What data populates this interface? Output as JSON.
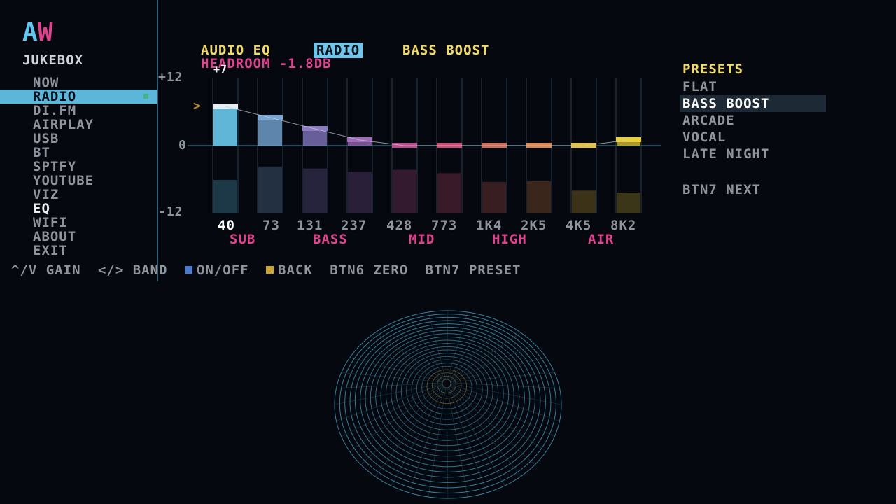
{
  "brand": {
    "logo_a": "A",
    "logo_w": "W",
    "title": "JUKEBOX"
  },
  "menu": {
    "items": [
      {
        "label": "NOW"
      },
      {
        "label": "RADIO",
        "selected": true
      },
      {
        "label": "DI.FM"
      },
      {
        "label": "AIRPLAY"
      },
      {
        "label": "USB"
      },
      {
        "label": "BT"
      },
      {
        "label": "SPTFY"
      },
      {
        "label": "YOUTUBE"
      },
      {
        "label": "VIZ"
      },
      {
        "label": "EQ",
        "current": true
      },
      {
        "label": "WIFI"
      },
      {
        "label": "ABOUT"
      },
      {
        "label": "EXIT"
      }
    ]
  },
  "eq": {
    "title": "AUDIO EQ",
    "source": "RADIO",
    "preset": "BASS BOOST",
    "headroom": "HEADROOM -1.8DB",
    "gain_popup": "+7",
    "y_max_label": "+12",
    "y_zero_label": "0",
    "y_min_label": "-12",
    "ylim": [
      -12,
      12
    ],
    "selected_band": 0,
    "bands": [
      {
        "freq": "40",
        "gain": 7,
        "color": "#5fb6d6",
        "cap": "#e8ecf0"
      },
      {
        "freq": "73",
        "gain": 5,
        "color": "#6f9cc8",
        "cap": "#7aa6d4"
      },
      {
        "freq": "131",
        "gain": 3,
        "color": "#7a6fb3",
        "cap": "#8a7cc0"
      },
      {
        "freq": "237",
        "gain": 1,
        "color": "#8c5fa6",
        "cap": "#a06aba"
      },
      {
        "freq": "428",
        "gain": 0,
        "color": "#b04a86",
        "cap": "#c04a8e"
      },
      {
        "freq": "773",
        "gain": 0,
        "color": "#c04a6a",
        "cap": "#d44a76"
      },
      {
        "freq": "1K4",
        "gain": 0,
        "color": "#c05a50",
        "cap": "#d66a58"
      },
      {
        "freq": "2K5",
        "gain": 0,
        "color": "#c8783c",
        "cap": "#e0884a"
      },
      {
        "freq": "4K5",
        "gain": 0,
        "color": "#c8a030",
        "cap": "#e4c040"
      },
      {
        "freq": "8K2",
        "gain": 1,
        "color": "#c8b030",
        "cap": "#e8cf3a"
      }
    ],
    "level_fraction": [
      0.49,
      0.69,
      0.66,
      0.61,
      0.64,
      0.59,
      0.46,
      0.47,
      0.33,
      0.3
    ],
    "groups": [
      "SUB",
      "BASS",
      "MID",
      "HIGH",
      "AIR"
    ]
  },
  "presets": {
    "title": "PRESETS",
    "items": [
      {
        "label": "FLAT"
      },
      {
        "label": "BASS BOOST",
        "selected": true
      },
      {
        "label": "ARCADE"
      },
      {
        "label": "VOCAL"
      },
      {
        "label": "LATE NIGHT"
      }
    ],
    "next_hint": "BTN7 NEXT"
  },
  "footer": {
    "gain": "^/V GAIN",
    "band": "</> BAND",
    "onoff": "ON/OFF",
    "back": "BACK",
    "zero": "BTN6 ZERO",
    "preset": "BTN7 PRESET"
  },
  "colors": {
    "accent": "#5fc6f0",
    "pink": "#e0438e",
    "yellow": "#f2da68",
    "background": "#05080f",
    "viz_line": "#3b7f9c"
  }
}
